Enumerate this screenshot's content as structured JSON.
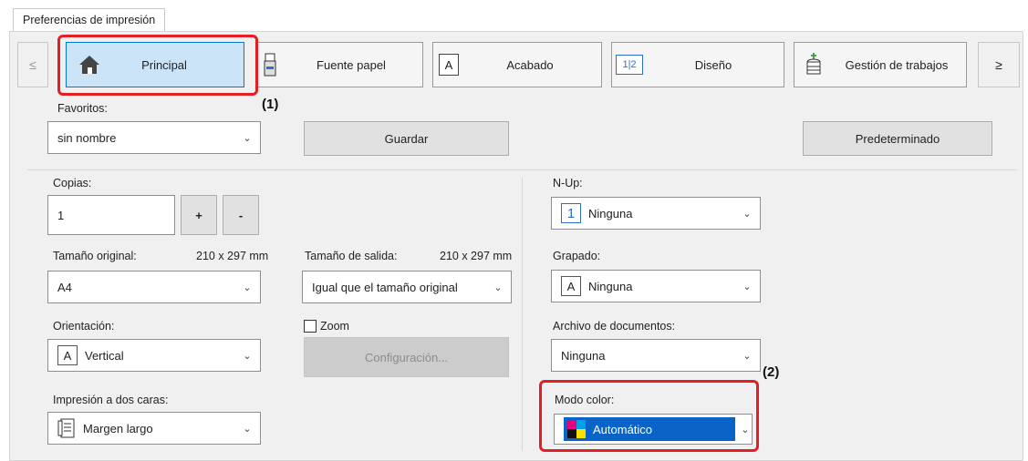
{
  "window": {
    "title": "Preferencias de impresión"
  },
  "nav": {
    "prev": "≤",
    "next": "≥",
    "tabs": [
      {
        "label": "Principal",
        "icon": "home-icon"
      },
      {
        "label": "Fuente papel",
        "icon": "paper-source-icon"
      },
      {
        "label": "Acabado",
        "icon": "finishing-icon",
        "icon_glyph": "A"
      },
      {
        "label": "Diseño",
        "icon": "layout-icon",
        "icon_glyph": "1|2"
      },
      {
        "label": "Gestión de trabajos",
        "icon": "job-management-icon"
      }
    ],
    "active": "Principal"
  },
  "favoritos": {
    "label": "Favoritos:",
    "value": "sin nombre"
  },
  "buttons": {
    "guardar": "Guardar",
    "predeterminado": "Predeterminado",
    "configuracion": "Configuración...",
    "plus": "+",
    "minus": "-"
  },
  "copias": {
    "label": "Copias:",
    "value": "1"
  },
  "tamano_original": {
    "label": "Tamaño original:",
    "size": "210 x 297 mm",
    "value": "A4"
  },
  "tamano_salida": {
    "label": "Tamaño de salida:",
    "size": "210 x 297 mm",
    "value": "Igual que el tamaño original"
  },
  "orientacion": {
    "label": "Orientación:",
    "value": "Vertical",
    "icon_glyph": "A"
  },
  "zoom": {
    "label": "Zoom",
    "checked": false
  },
  "dos_caras": {
    "label": "Impresión a dos caras:",
    "value": "Margen largo"
  },
  "nup": {
    "label": "N-Up:",
    "value": "Ninguna",
    "icon_glyph": "1"
  },
  "grapado": {
    "label": "Grapado:",
    "value": "Ninguna",
    "icon_glyph": "A"
  },
  "archivo": {
    "label": "Archivo de documentos:",
    "value": "Ninguna"
  },
  "modo_color": {
    "label": "Modo color:",
    "value": "Automático"
  },
  "callouts": {
    "one": "(1)",
    "two": "(2)"
  },
  "colors": {
    "highlight": "#e31e24",
    "active_tab_bg": "#cce4f7",
    "active_tab_border": "#0078d7",
    "selected_bg": "#0a64c8"
  }
}
